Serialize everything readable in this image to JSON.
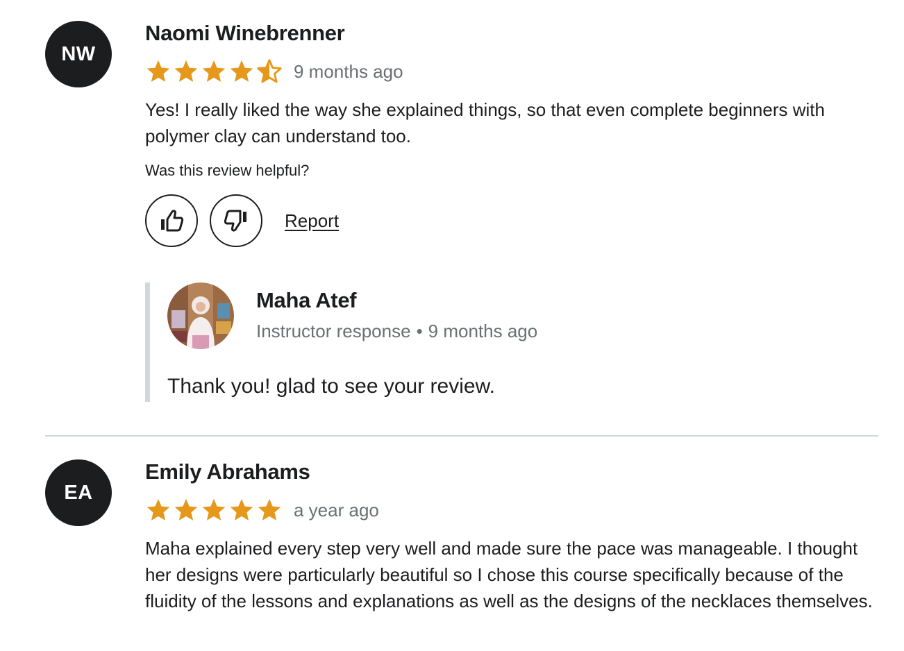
{
  "reviews": [
    {
      "initials": "NW",
      "name": "Naomi Winebrenner",
      "rating": 4.5,
      "time": "9 months ago",
      "text": "Yes! I really liked the way she explained things, so that even complete beginners with polymer clay can understand too.",
      "helpful_question": "Was this review helpful?",
      "report_label": "Report",
      "instructor_response": {
        "name": "Maha Atef",
        "label": "Instructor response",
        "separator": "•",
        "time": "9 months ago",
        "text": "Thank you! glad to see your review."
      }
    },
    {
      "initials": "EA",
      "name": "Emily Abrahams",
      "rating": 5,
      "time": "a year ago",
      "text": "Maha explained every step very well and made sure the pace was manageable. I thought her designs were particularly beautiful so I chose this course specifically because of the fluidity of the lessons and explanations as well as the designs of the necklaces themselves."
    }
  ],
  "colors": {
    "star": "#e59819",
    "text": "#1c1d1f",
    "muted": "#6a6f73",
    "border": "#d1d7dc",
    "avatar_bg": "#1c1d1f"
  },
  "icons": {
    "thumbs_up": "thumbs-up-icon",
    "thumbs_down": "thumbs-down-icon",
    "star_full": "star-icon",
    "star_half": "star-half-icon"
  }
}
